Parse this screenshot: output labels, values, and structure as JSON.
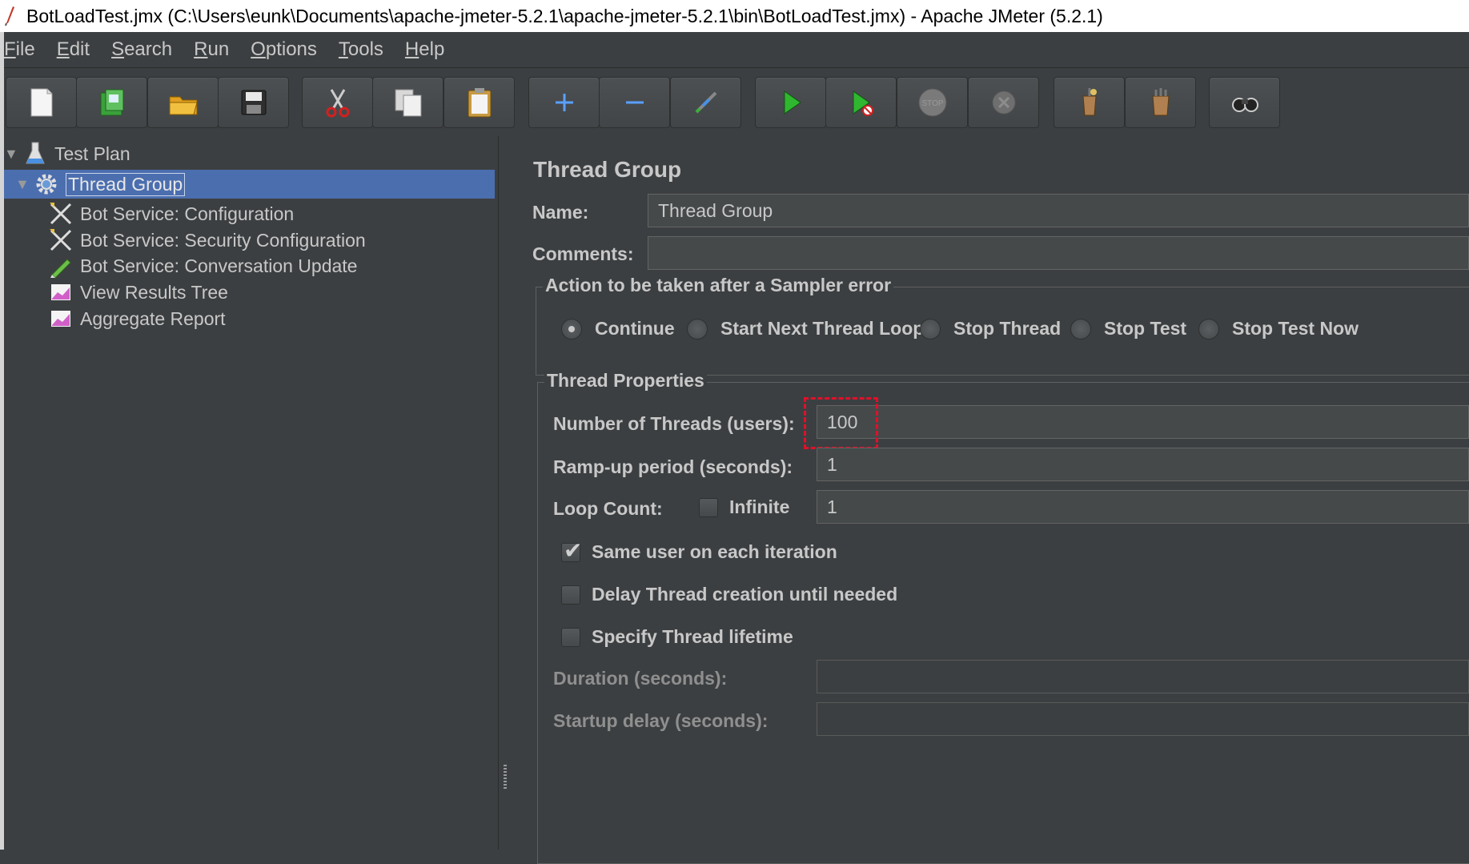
{
  "window": {
    "title": "BotLoadTest.jmx (C:\\Users\\eunk\\Documents\\apache-jmeter-5.2.1\\apache-jmeter-5.2.1\\bin\\BotLoadTest.jmx) - Apache JMeter (5.2.1)"
  },
  "menu": [
    {
      "mnemonic": "F",
      "rest": "ile"
    },
    {
      "mnemonic": "E",
      "rest": "dit"
    },
    {
      "mnemonic": "S",
      "rest": "earch"
    },
    {
      "mnemonic": "R",
      "rest": "un"
    },
    {
      "mnemonic": "O",
      "rest": "ptions"
    },
    {
      "mnemonic": "T",
      "rest": "ools"
    },
    {
      "mnemonic": "H",
      "rest": "elp"
    }
  ],
  "toolbar": {
    "icons": [
      "new-icon",
      "templates-icon",
      "open-icon",
      "save-icon",
      "cut-icon",
      "copy-icon",
      "paste-icon",
      "expand-icon",
      "collapse-icon",
      "toggle-icon",
      "start-icon",
      "start-no-timers-icon",
      "stop-icon",
      "shutdown-icon",
      "clear-icon",
      "clear-all-icon",
      "search-icon"
    ]
  },
  "tree": {
    "items": [
      {
        "label": "Test Plan",
        "icon": "test-plan-icon"
      },
      {
        "label": "Thread Group",
        "icon": "gear-icon"
      },
      {
        "label": "Bot Service: Configuration",
        "icon": "config-tools-icon"
      },
      {
        "label": "Bot Service: Security Configuration",
        "icon": "config-tools-icon"
      },
      {
        "label": "Bot Service: Conversation Update",
        "icon": "sampler-pencil-icon"
      },
      {
        "label": "View Results Tree",
        "icon": "listener-graph-icon"
      },
      {
        "label": "Aggregate Report",
        "icon": "listener-graph-icon"
      }
    ]
  },
  "panel": {
    "title": "Thread Group",
    "name_label": "Name:",
    "name_value": "Thread Group",
    "comments_label": "Comments:",
    "comments_value": "",
    "action_group_title": "Action to be taken after a Sampler error",
    "actions": [
      "Continue",
      "Start Next Thread Loop",
      "Stop Thread",
      "Stop Test",
      "Stop Test Now"
    ],
    "selected_action": "Continue",
    "thread_props_title": "Thread Properties",
    "threads_label": "Number of Threads (users):",
    "threads_value": "100",
    "rampup_label": "Ramp-up period (seconds):",
    "rampup_value": "1",
    "loop_label": "Loop Count:",
    "infinite_label": "Infinite",
    "infinite_checked": false,
    "loop_value": "1",
    "same_user_label": "Same user on each iteration",
    "same_user_checked": true,
    "delay_label": "Delay Thread creation until needed",
    "delay_checked": false,
    "lifetime_label": "Specify Thread lifetime",
    "lifetime_checked": false,
    "duration_label": "Duration (seconds):",
    "duration_value": "",
    "startup_label": "Startup delay (seconds):",
    "startup_value": ""
  },
  "colors": {
    "background": "#3c3f41",
    "selection": "#4b6eaf",
    "highlight": "#e0102a"
  }
}
